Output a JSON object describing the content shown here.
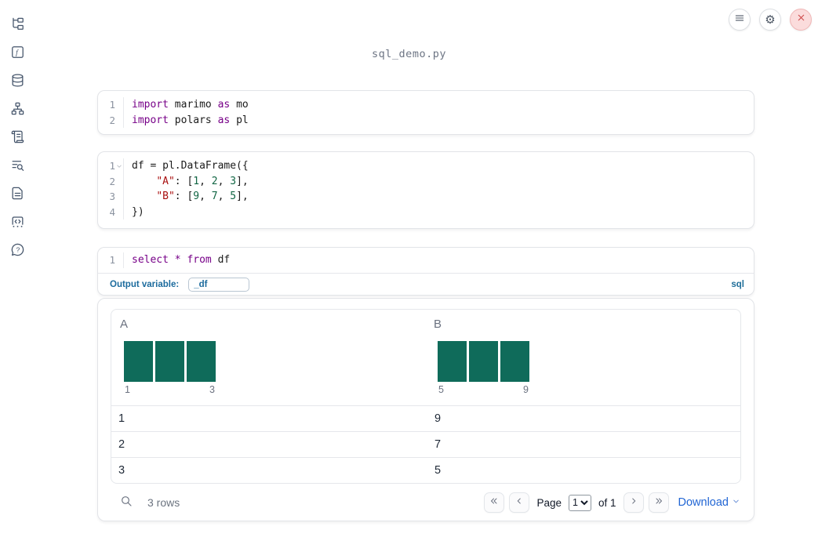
{
  "header": {
    "filename": "sql_demo.py"
  },
  "topbar": {
    "buttons": [
      {
        "name": "menu-button",
        "icon": "hamburger-icon"
      },
      {
        "name": "settings-button",
        "icon": "gear-icon"
      },
      {
        "name": "close-button",
        "icon": "close-x-icon"
      }
    ],
    "gear_glyph": "⚙"
  },
  "sidebar": {
    "items": [
      {
        "name": "file-tree",
        "icon": "tree-icon"
      },
      {
        "name": "functions",
        "icon": "function-icon"
      },
      {
        "name": "datasources",
        "icon": "database-icon"
      },
      {
        "name": "dependency-graph",
        "icon": "graph-icon"
      },
      {
        "name": "scroll-log",
        "icon": "scroll-icon"
      },
      {
        "name": "search-list",
        "icon": "list-search-icon"
      },
      {
        "name": "document",
        "icon": "document-icon"
      },
      {
        "name": "snippets",
        "icon": "code-box-icon"
      },
      {
        "name": "help",
        "icon": "help-icon"
      }
    ]
  },
  "code_cells": [
    {
      "id": "cell-imports",
      "lines": [
        {
          "n": "1",
          "tokens": [
            [
              "kw",
              "import"
            ],
            [
              "pl",
              " marimo "
            ],
            [
              "kw",
              "as"
            ],
            [
              "pl",
              " mo"
            ]
          ]
        },
        {
          "n": "2",
          "tokens": [
            [
              "kw",
              "import"
            ],
            [
              "pl",
              " polars "
            ],
            [
              "kw",
              "as"
            ],
            [
              "pl",
              " pl"
            ]
          ]
        }
      ]
    },
    {
      "id": "cell-dataframe",
      "lines": [
        {
          "n": "1",
          "fold": true,
          "tokens": [
            [
              "pl",
              "df = pl.DataFrame({"
            ]
          ]
        },
        {
          "n": "2",
          "tokens": [
            [
              "pl",
              "    "
            ],
            [
              "str",
              "\"A\""
            ],
            [
              "pl",
              ": ["
            ],
            [
              "num",
              "1"
            ],
            [
              "pl",
              ", "
            ],
            [
              "num",
              "2"
            ],
            [
              "pl",
              ", "
            ],
            [
              "num",
              "3"
            ],
            [
              "pl",
              "],"
            ]
          ]
        },
        {
          "n": "3",
          "tokens": [
            [
              "pl",
              "    "
            ],
            [
              "str",
              "\"B\""
            ],
            [
              "pl",
              ": ["
            ],
            [
              "num",
              "9"
            ],
            [
              "pl",
              ", "
            ],
            [
              "num",
              "7"
            ],
            [
              "pl",
              ", "
            ],
            [
              "num",
              "5"
            ],
            [
              "pl",
              "],"
            ]
          ]
        },
        {
          "n": "4",
          "tokens": [
            [
              "pl",
              "})"
            ]
          ]
        }
      ]
    },
    {
      "id": "cell-sql",
      "lines": [
        {
          "n": "1",
          "tokens": [
            [
              "kw",
              "select"
            ],
            [
              "pl",
              " "
            ],
            [
              "kw",
              "*"
            ],
            [
              "pl",
              " "
            ],
            [
              "kw",
              "from"
            ],
            [
              "pl",
              " df"
            ]
          ]
        }
      ]
    }
  ],
  "sql_cell": {
    "output_variable_label": "Output variable:",
    "output_variable_value": "_df",
    "language_label": "sql"
  },
  "table": {
    "columns": [
      {
        "header": "A",
        "hist": {
          "bars": [
            1,
            1,
            1
          ],
          "min_label": "1",
          "max_label": "3"
        }
      },
      {
        "header": "B",
        "hist": {
          "bars": [
            1,
            1,
            1
          ],
          "min_label": "5",
          "max_label": "9"
        }
      }
    ],
    "rows": [
      [
        "1",
        "9"
      ],
      [
        "2",
        "7"
      ],
      [
        "3",
        "5"
      ]
    ],
    "footer": {
      "rows_label": "3 rows",
      "page_label": "Page",
      "page_value": "1",
      "of_label": "of 1",
      "download_label": "Download"
    }
  },
  "colors": {
    "histogram_teal": "#0f6b5a",
    "keyword_purple": "#770088",
    "string_red": "#aa1111",
    "number_green": "#116644",
    "accent_blue": "#1c6b9d",
    "link_blue": "#2266d4",
    "close_red": "#cc4444"
  }
}
